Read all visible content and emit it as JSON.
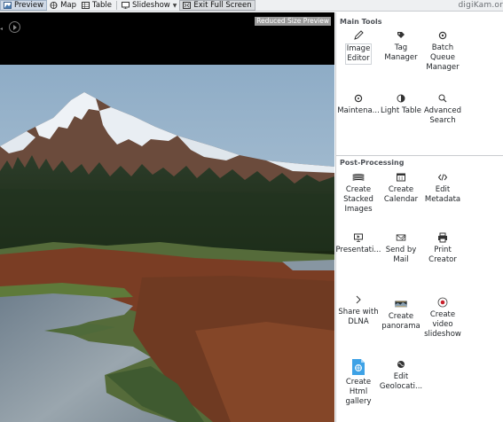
{
  "toolbar": {
    "items": [
      {
        "label": "Preview",
        "icon": "preview-icon",
        "state": "active"
      },
      {
        "label": "Map",
        "icon": "map-icon",
        "state": "normal"
      },
      {
        "label": "Table",
        "icon": "table-icon",
        "state": "normal"
      },
      {
        "label": "Slideshow",
        "icon": "slideshow-icon",
        "state": "normal",
        "has_dropdown": true
      },
      {
        "label": "Exit Full Screen",
        "icon": "exit-fullscreen-icon",
        "state": "pressed"
      }
    ],
    "app_name": "digiKam.or"
  },
  "preview": {
    "overlay_label": "Reduced Size Preview"
  },
  "panel": {
    "main_tools": {
      "title": "Main Tools",
      "items": [
        {
          "label": "Image\nEditor",
          "icon": "pencil-icon"
        },
        {
          "label": "Tag\nManager",
          "icon": "tag-icon"
        },
        {
          "label": "Batch\nQueue\nManager",
          "icon": "gear-icon"
        },
        {
          "label": "Maintena...",
          "icon": "maintenance-icon"
        },
        {
          "label": "Light Table",
          "icon": "light-table-icon"
        },
        {
          "label": "Advanced\nSearch",
          "icon": "search-icon"
        }
      ]
    },
    "post_processing": {
      "title": "Post-Processing",
      "items": [
        {
          "label": "Create\nStacked\nImages",
          "icon": "stack-icon"
        },
        {
          "label": "Create\nCalendar",
          "icon": "calendar-icon"
        },
        {
          "label": "Edit\nMetadata",
          "icon": "code-icon"
        },
        {
          "label": "Presentati...",
          "icon": "presentation-icon"
        },
        {
          "label": "Send by\nMail",
          "icon": "mail-icon"
        },
        {
          "label": "Print\nCreator",
          "icon": "printer-icon"
        },
        {
          "label": "Share with\nDLNA",
          "icon": "dlna-icon"
        },
        {
          "label": "Create\npanorama",
          "icon": "panorama-icon"
        },
        {
          "label": "Create\nvideo\nslideshow",
          "icon": "video-slideshow-icon"
        },
        {
          "label": "Create\nHtml\ngallery",
          "icon": "html-gallery-icon"
        },
        {
          "label": "Edit\nGeolocati...",
          "icon": "globe-icon"
        }
      ]
    }
  },
  "colors": {
    "toolbar_bg": "#eef0f2",
    "active_tab": "#cfd9e6",
    "sky": "#9bb7cf",
    "forest": "#1d2e1c",
    "brush": "#7a3d24",
    "water": "#7f8e99"
  }
}
